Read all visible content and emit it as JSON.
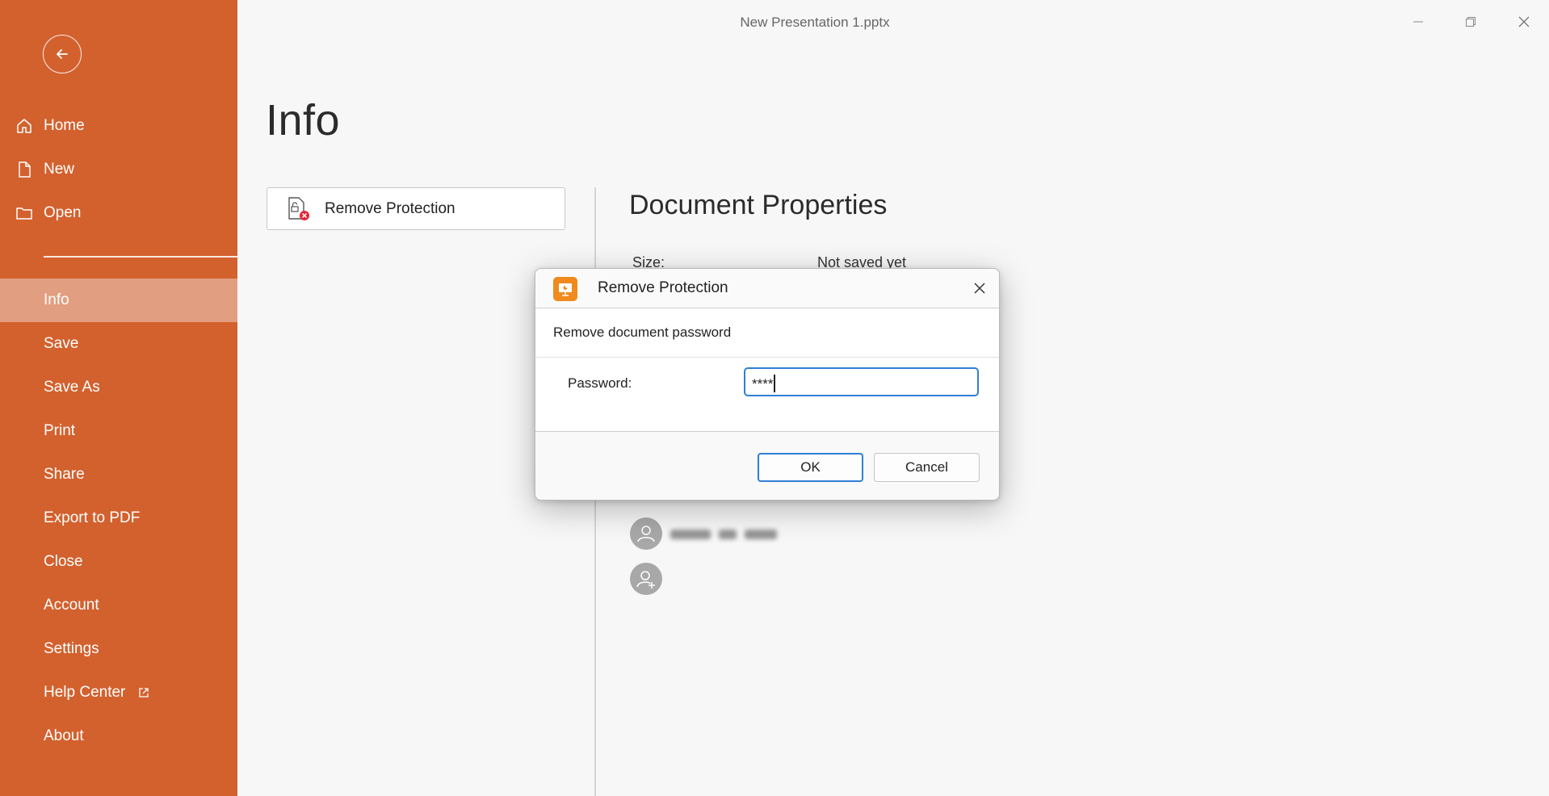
{
  "window": {
    "title": "New Presentation 1.pptx"
  },
  "sidebar": {
    "accent": "#d3612e",
    "active_bg": "#e29e80",
    "items_top": [
      {
        "label": "Home",
        "icon": "home-icon"
      },
      {
        "label": "New",
        "icon": "file-icon"
      },
      {
        "label": "Open",
        "icon": "folder-icon"
      }
    ],
    "items": [
      {
        "label": "Info",
        "active": true
      },
      {
        "label": "Save"
      },
      {
        "label": "Save As"
      },
      {
        "label": "Print"
      },
      {
        "label": "Share"
      },
      {
        "label": "Export to PDF"
      },
      {
        "label": "Close"
      },
      {
        "label": "Account"
      },
      {
        "label": "Settings"
      },
      {
        "label": "Help Center",
        "icon": "external-link-icon"
      },
      {
        "label": "About"
      }
    ]
  },
  "main": {
    "title": "Info",
    "remove_protection_label": "Remove Protection",
    "properties": {
      "title": "Document Properties",
      "size_label": "Size:",
      "size_value": "Not saved yet"
    }
  },
  "dialog": {
    "title": "Remove Protection",
    "subtitle": "Remove document password",
    "password_label": "Password:",
    "password_value": "****",
    "ok_label": "OK",
    "cancel_label": "Cancel",
    "focus_color": "#2f7fd6"
  }
}
